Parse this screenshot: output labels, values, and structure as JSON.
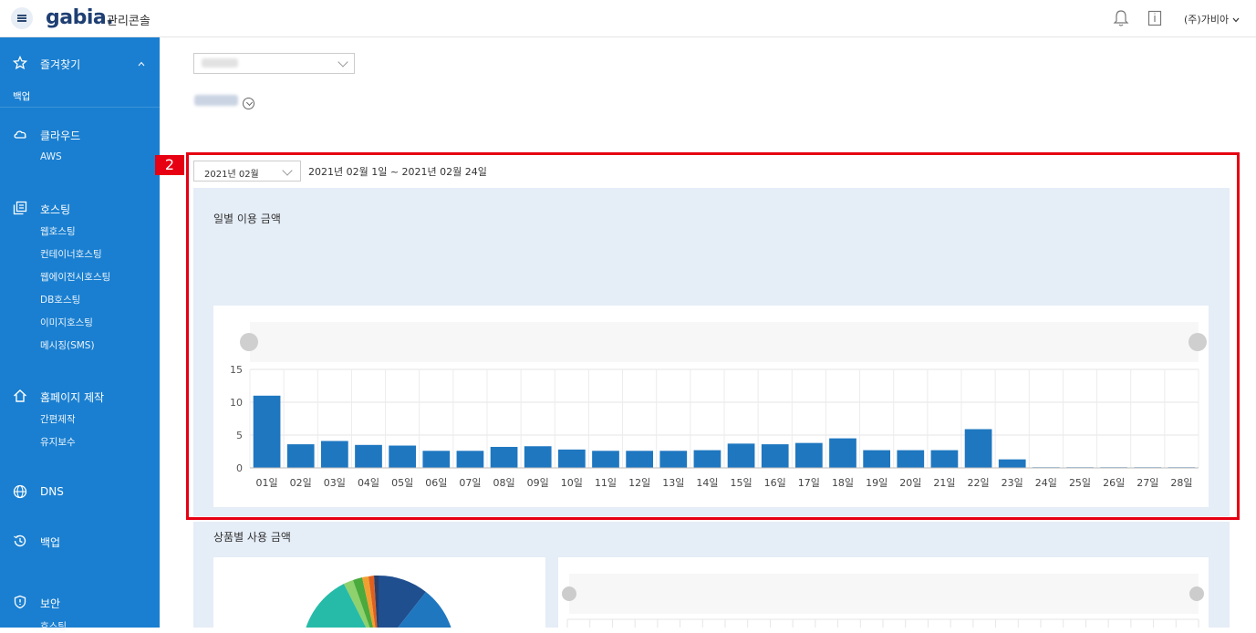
{
  "header": {
    "logo": "gabia.",
    "console_title": "관리콘솔",
    "company_menu": "(주)가비아"
  },
  "sidebar": {
    "favorites": {
      "label": "즐겨찾기",
      "items": [
        "백업"
      ]
    },
    "cloud": {
      "label": "클라우드",
      "items": [
        "AWS"
      ]
    },
    "hosting": {
      "label": "호스팅",
      "items": [
        "웹호스팅",
        "컨테이너호스팅",
        "웹에이전시호스팅",
        "DB호스팅",
        "이미지호스팅",
        "메시징(SMS)"
      ]
    },
    "homepage": {
      "label": "홈페이지 제작",
      "items": [
        "간편제작",
        "유지보수"
      ]
    },
    "dns": {
      "label": "DNS"
    },
    "backup": {
      "label": "백업"
    },
    "security": {
      "label": "보안",
      "items": [
        "호스팅"
      ]
    }
  },
  "annotation": {
    "number": "2"
  },
  "period": {
    "selected_month": "2021년 02월",
    "range_text": "2021년 02월 1일 ~ 2021년 02월 24일"
  },
  "daily_panel": {
    "title": "일별 이용 금액"
  },
  "product_panel": {
    "title": "상품별 사용 금액"
  },
  "colors": {
    "sidebar": "#1a7fd0",
    "bar": "#1f77c0",
    "annotation": "#e60012",
    "panel": "#e5edf7"
  },
  "chart_data": {
    "type": "bar",
    "categories": [
      "01일",
      "02일",
      "03일",
      "04일",
      "05일",
      "06일",
      "07일",
      "08일",
      "09일",
      "10일",
      "11일",
      "12일",
      "13일",
      "14일",
      "15일",
      "16일",
      "17일",
      "18일",
      "19일",
      "20일",
      "21일",
      "22일",
      "23일",
      "24일",
      "25일",
      "26일",
      "27일",
      "28일"
    ],
    "values": [
      11,
      3.6,
      4.1,
      3.5,
      3.4,
      2.6,
      2.6,
      3.2,
      3.3,
      2.8,
      2.6,
      2.6,
      2.6,
      2.7,
      3.7,
      3.6,
      3.8,
      4.5,
      2.7,
      2.7,
      2.7,
      5.9,
      1.3,
      0.1,
      0.1,
      0.1,
      0.1,
      0.1
    ],
    "yticks": [
      0,
      5,
      10,
      15
    ],
    "ylim": [
      0,
      15
    ]
  }
}
